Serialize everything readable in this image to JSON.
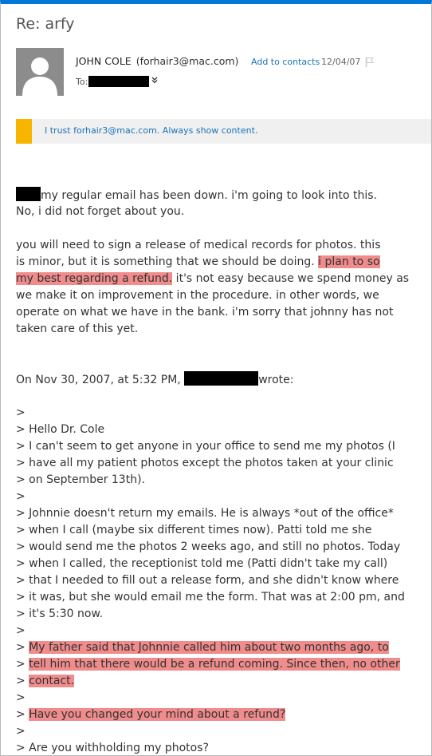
{
  "window": {
    "subject": "Re: arfy"
  },
  "header": {
    "sender_name": "JOHN COLE",
    "sender_email": "(forhair3@mac.com)",
    "add_contacts": "Add to contacts",
    "date": "12/04/07",
    "to_label": "To:"
  },
  "trust_bar": {
    "text": "I trust forhair3@mac.com. Always show content."
  },
  "body": {
    "p1_line1": "my regular email has been down. i'm going to look into this.",
    "p1_line2": "No, i did not forget about you.",
    "p2_line1": "you will need to sign a release of medical records for photos. this",
    "p2_line2_pre": "is minor, but it is something that we should be doing. ",
    "p2_line2_hl": "i plan to so",
    "p2_line3_hl": "my best regarding a refund.",
    "p2_line3_post": " it's not easy because we spend money as",
    "p2_line4": "we make it on improvement in the procedure. in other words, we",
    "p2_line5": "operate on what we have in the bank. i'm sorry that johnny has not",
    "p2_line6": "taken care of this yet.",
    "quote_header_pre": "On Nov 30, 2007, at 5:32 PM,",
    "quote_header_post": "wrote:",
    "q1": ">",
    "q2": "> Hello Dr. Cole",
    "q3": "> I can't seem to get anyone in your office to send me my photos (I",
    "q4": "> have all my patient photos except the photos taken at your clinic",
    "q5": "> on September 13th).",
    "q6": ">",
    "q7": "> Johnnie doesn't return my emails. He is always *out of the office*",
    "q8": "> when I call (maybe six different times now). Patti told me she",
    "q9": "> would send me the photos 2 weeks ago, and still no photos. Today",
    "q10": "> when I called, the receptionist told me (Patti didn't take my call)",
    "q11": "> that I needed to fill out a release form, and she didn't know where",
    "q12": "> it was, but she would email me the form. That was at 2:00 pm, and",
    "q13": "> it's 5:30 now.",
    "q14": ">",
    "q15_prefix": "> ",
    "q15_hl": "My father said that Johnnie called him about two months ago, to",
    "q16_prefix": "> ",
    "q16_hl": "tell him that there would be a refund coming. Since then, no other",
    "q17_prefix": "> ",
    "q17_hl": "contact.",
    "q18": ">",
    "q19_prefix": "> ",
    "q19_hl": "Have you changed your mind about a refund?",
    "q20": ">",
    "q21": "> Are you withholding my photos?"
  },
  "colors": {
    "accent": "#0078d7",
    "highlight": "#f08c8c",
    "trust_stripe": "#f7b500",
    "link": "#1a73b8"
  },
  "icons": [
    "avatar-person-icon",
    "flag-icon",
    "expand-chevron-icon"
  ]
}
